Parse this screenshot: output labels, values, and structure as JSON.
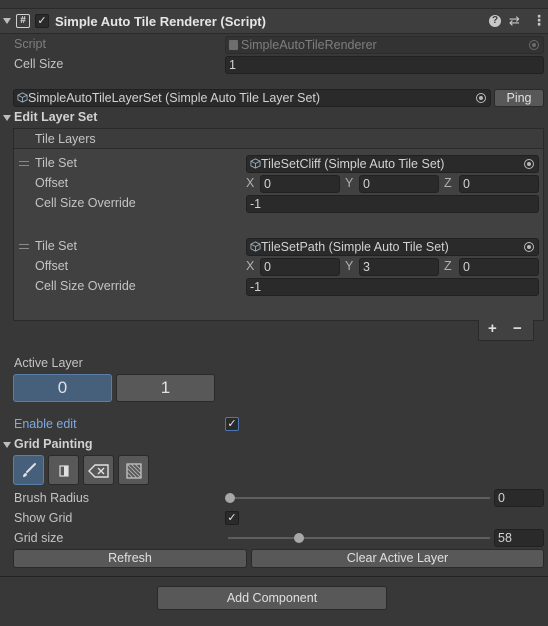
{
  "component": {
    "title": "Simple Auto Tile Renderer (Script)",
    "enabled_check": "✓",
    "script_icon": "#",
    "help_icon": "?",
    "presets_icon": "⇄",
    "menu_icon": "⋮"
  },
  "fields": {
    "script_label": "Script",
    "script_value": "SimpleAutoTileRenderer",
    "cell_size_label": "Cell Size",
    "cell_size_value": "1",
    "layer_set_value": "SimpleAutoTileLayerSet (Simple Auto Tile Layer Set)",
    "ping_label": "Ping"
  },
  "edit_layer_set": {
    "title": "Edit Layer Set",
    "list_header": "Tile Layers",
    "items": [
      {
        "tile_set_label": "Tile Set",
        "tile_set_value": "TileSetCliff (Simple Auto Tile Set)",
        "offset_label": "Offset",
        "x": "0",
        "y": "0",
        "z": "0",
        "override_label": "Cell Size Override",
        "override_value": "-1"
      },
      {
        "tile_set_label": "Tile Set",
        "tile_set_value": "TileSetPath (Simple Auto Tile Set)",
        "offset_label": "Offset",
        "x": "0",
        "y": "3",
        "z": "0",
        "override_label": "Cell Size Override",
        "override_value": "-1"
      }
    ],
    "axis_x": "X",
    "axis_y": "Y",
    "axis_z": "Z",
    "add_label": "+",
    "remove_label": "−"
  },
  "active_layer": {
    "label": "Active Layer",
    "options": [
      "0",
      "1"
    ],
    "selected": 0
  },
  "enable_edit": {
    "label": "Enable edit",
    "checked": true,
    "check": "✓"
  },
  "grid_painting": {
    "title": "Grid Painting",
    "tools": [
      "brush-icon",
      "fill-icon",
      "eraser-icon",
      "clear-pattern-icon"
    ],
    "brush_radius_label": "Brush Radius",
    "brush_radius_value": "0",
    "show_grid_label": "Show Grid",
    "show_grid_check": "✓",
    "grid_size_label": "Grid size",
    "grid_size_value": "58"
  },
  "buttons": {
    "refresh": "Refresh",
    "clear_active_layer": "Clear Active Layer",
    "add_component": "Add Component"
  },
  "colors": {
    "background": "#383838",
    "accent_selected": "#46607c",
    "link_blue": "#7fa9e0"
  }
}
